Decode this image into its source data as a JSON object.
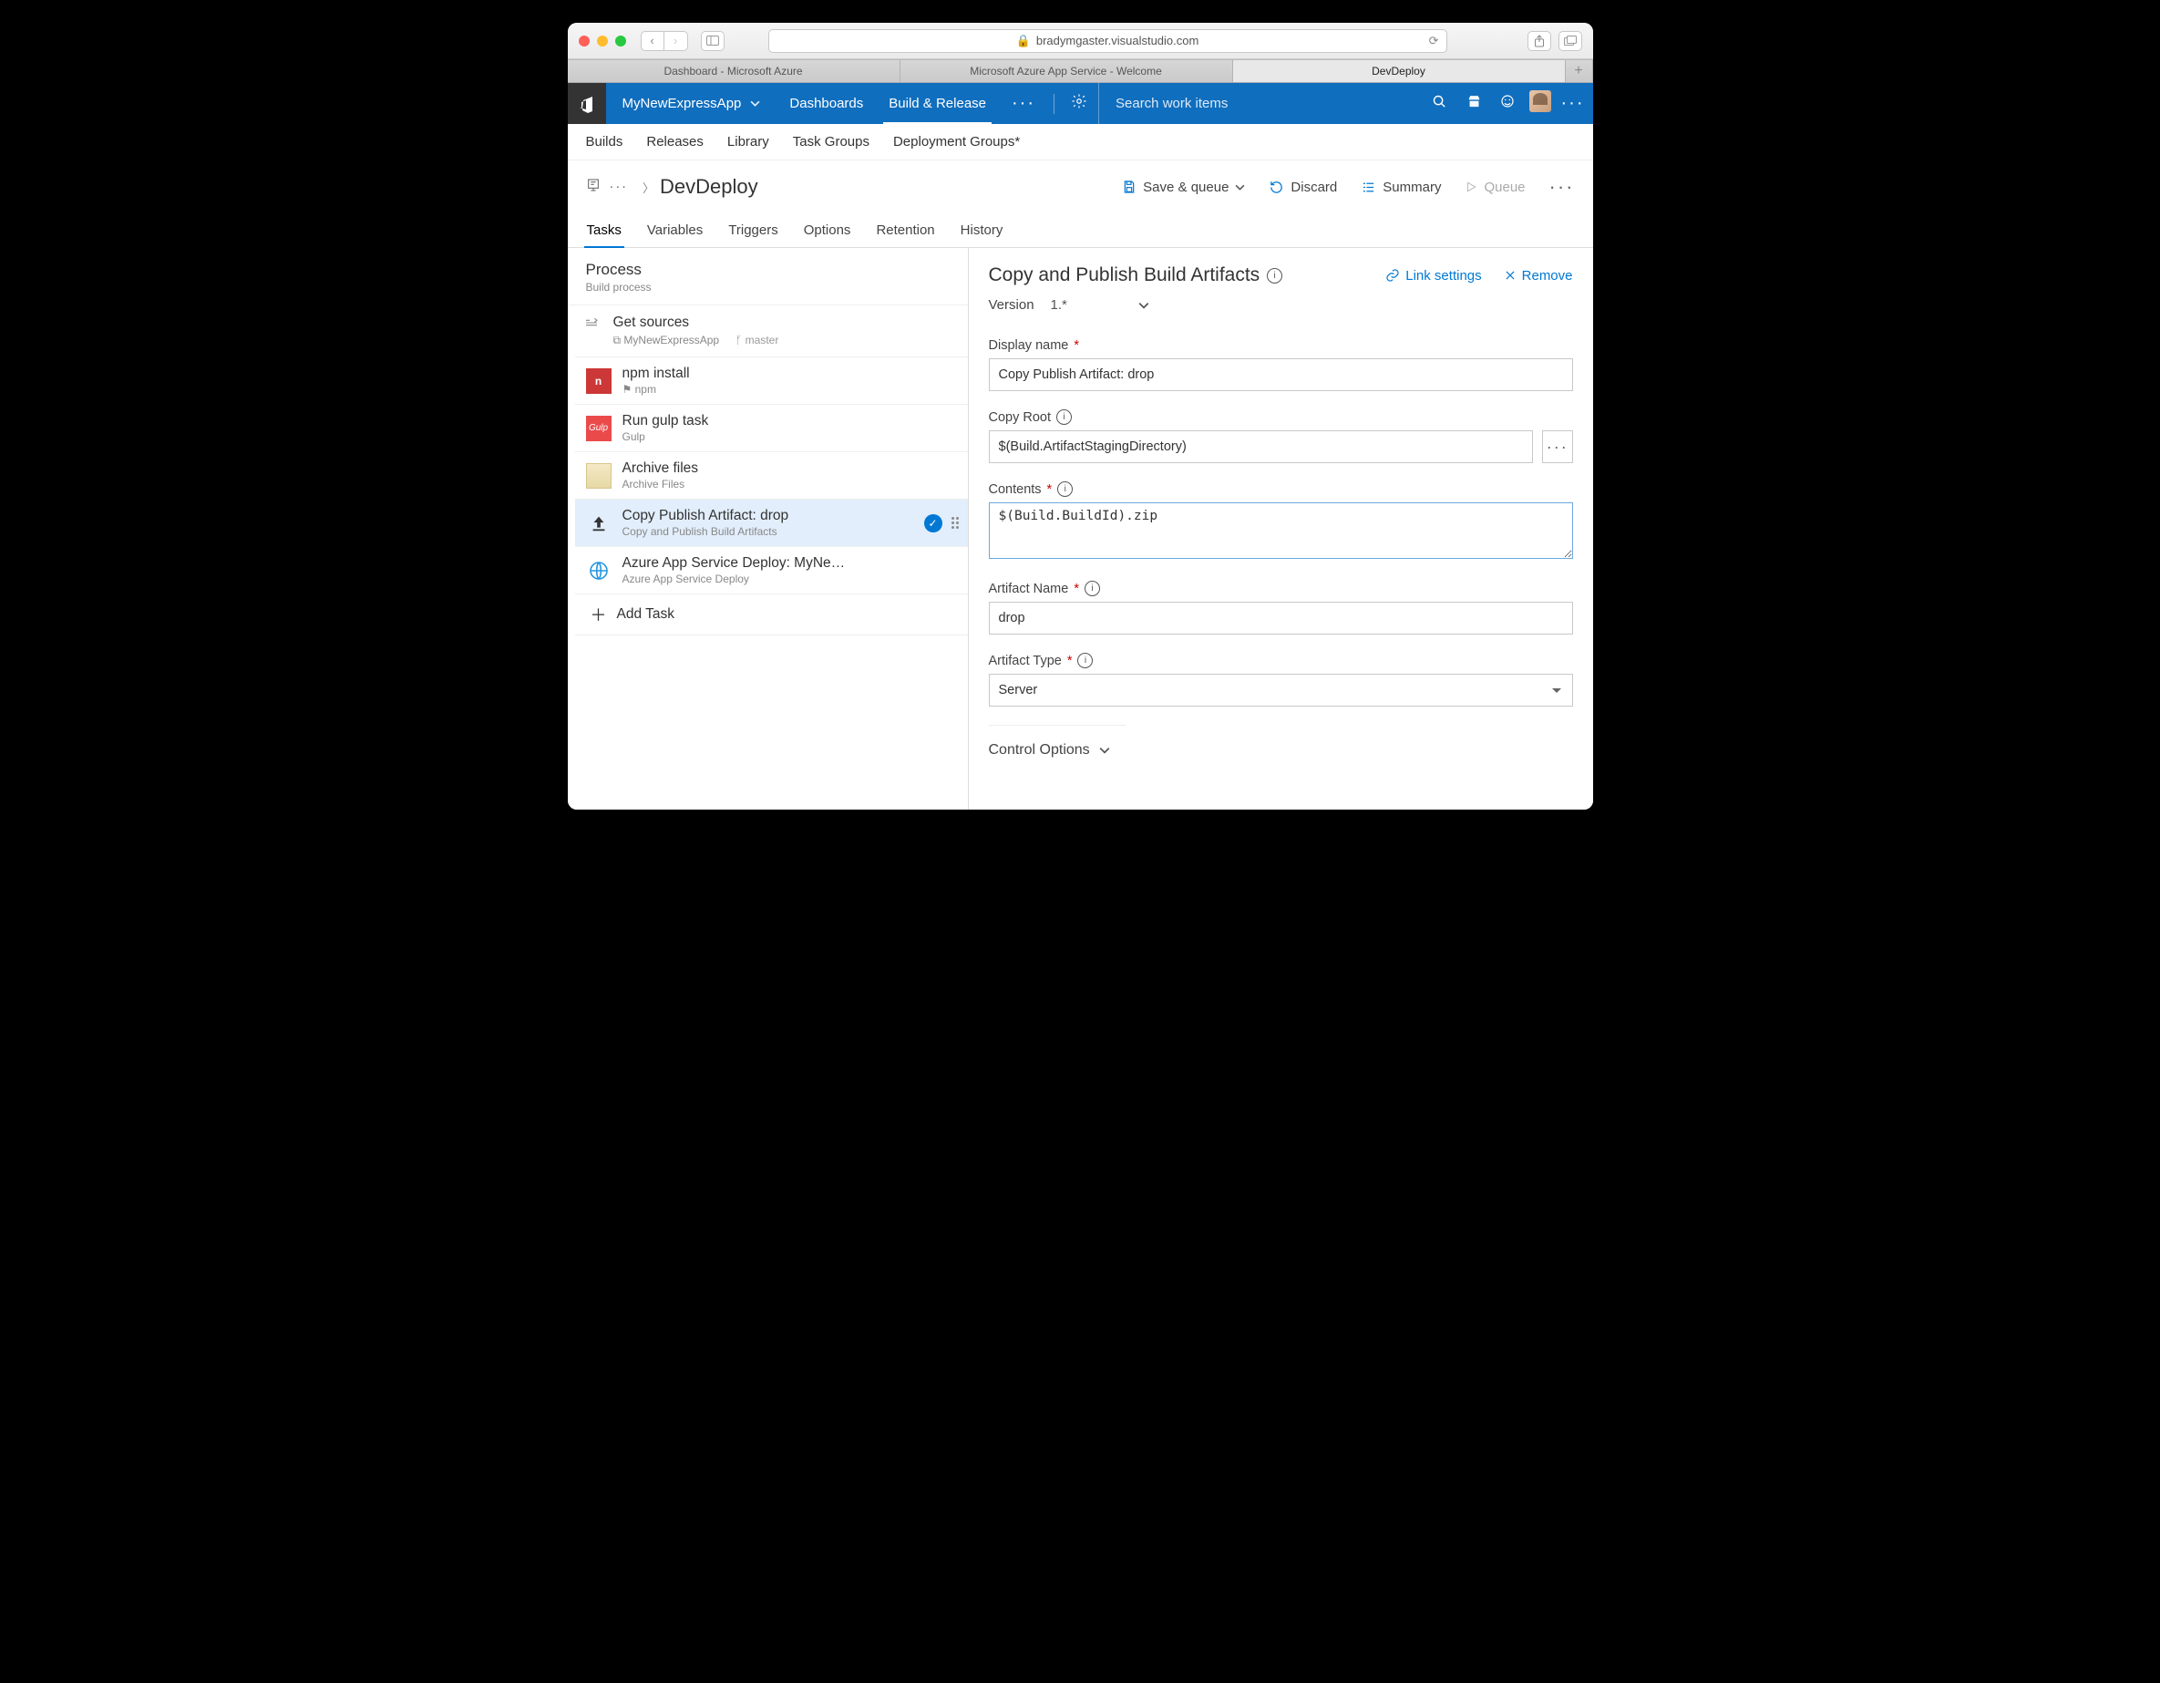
{
  "browser": {
    "url_host": "bradymgaster.visualstudio.com",
    "tabs": [
      "Dashboard - Microsoft Azure",
      "Microsoft Azure App Service - Welcome",
      "DevDeploy"
    ],
    "active_tab": 2
  },
  "topbar": {
    "project": "MyNewExpressApp",
    "items": [
      "Dashboards",
      "Build & Release"
    ],
    "active_item": 1,
    "search_placeholder": "Search work items"
  },
  "subnav": [
    "Builds",
    "Releases",
    "Library",
    "Task Groups",
    "Deployment Groups*"
  ],
  "breadcrumb": {
    "title": "DevDeploy"
  },
  "actions": {
    "save": "Save & queue",
    "discard": "Discard",
    "summary": "Summary",
    "queue": "Queue"
  },
  "page_tabs": [
    "Tasks",
    "Variables",
    "Triggers",
    "Options",
    "Retention",
    "History"
  ],
  "active_page_tab": 0,
  "process": {
    "title": "Process",
    "sub": "Build process"
  },
  "get_sources": {
    "label": "Get sources",
    "repo": "MyNewExpressApp",
    "branch": "master"
  },
  "tasks": [
    {
      "name": "npm install",
      "sub": "npm"
    },
    {
      "name": "Run gulp task",
      "sub": "Gulp"
    },
    {
      "name": "Archive files",
      "sub": "Archive Files"
    },
    {
      "name": "Copy Publish Artifact: drop",
      "sub": "Copy and Publish Build Artifacts"
    },
    {
      "name": "Azure App Service Deploy: MyNe…",
      "sub": "Azure App Service Deploy"
    }
  ],
  "selected_task": 3,
  "add_task_label": "Add Task",
  "detail": {
    "title": "Copy and Publish Build Artifacts",
    "link_settings": "Link settings",
    "remove": "Remove",
    "version_label": "Version",
    "version_value": "1.*",
    "display_name_label": "Display name",
    "display_name_value": "Copy Publish Artifact: drop",
    "copy_root_label": "Copy Root",
    "copy_root_value": "$(Build.ArtifactStagingDirectory)",
    "contents_label": "Contents",
    "contents_value": "$(Build.BuildId).zip",
    "artifact_name_label": "Artifact Name",
    "artifact_name_value": "drop",
    "artifact_type_label": "Artifact Type",
    "artifact_type_value": "Server",
    "control_options_label": "Control Options"
  }
}
